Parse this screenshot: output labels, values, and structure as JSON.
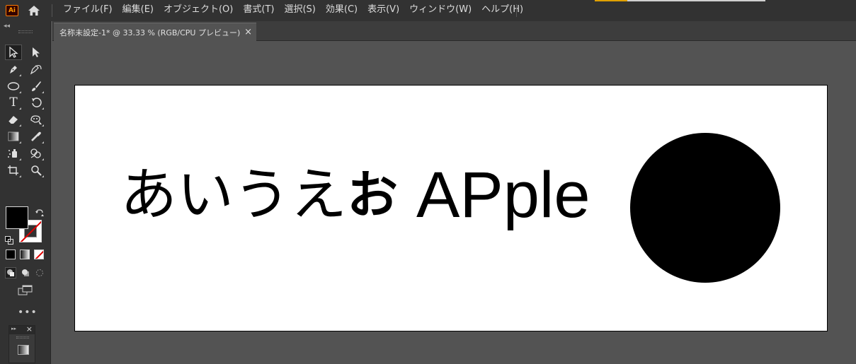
{
  "app": {
    "logo_text": "Ai"
  },
  "menu": {
    "items": [
      "ファイル(F)",
      "編集(E)",
      "オブジェクト(O)",
      "書式(T)",
      "選択(S)",
      "効果(C)",
      "表示(V)",
      "ウィンドウ(W)",
      "ヘルプ(H)"
    ]
  },
  "document_tab": {
    "title": "名称未設定-1* @ 33.33 % (RGB/CPU プレビュー)",
    "close_glyph": "×"
  },
  "toolbar": {
    "collapse_glyph": "◂◂",
    "more_glyph": "•••",
    "mini_panel_expand": "▸▸",
    "mini_panel_close": "×",
    "tools": [
      {
        "name": "selection-tool",
        "icon": "arrow-hollow-icon",
        "active": true
      },
      {
        "name": "direct-selection-tool",
        "icon": "arrow-filled-icon",
        "active": false
      },
      {
        "name": "pen-tool",
        "icon": "pen-icon",
        "active": false
      },
      {
        "name": "curvature-tool",
        "icon": "curvature-pen-icon",
        "active": false
      },
      {
        "name": "ellipse-tool",
        "icon": "ellipse-icon",
        "active": false
      },
      {
        "name": "paintbrush-tool",
        "icon": "brush-icon",
        "active": false
      },
      {
        "name": "type-tool",
        "icon": "type-icon",
        "active": false
      },
      {
        "name": "rotate-tool",
        "icon": "rotate-icon",
        "active": false
      },
      {
        "name": "eraser-tool",
        "icon": "eraser-icon",
        "active": false
      },
      {
        "name": "puppet-warp-tool",
        "icon": "puppet-warp-icon",
        "active": false
      },
      {
        "name": "gradient-tool",
        "icon": "gradient-icon",
        "active": false
      },
      {
        "name": "eyedropper-tool",
        "icon": "eyedropper-icon",
        "active": false
      },
      {
        "name": "symbol-sprayer-tool",
        "icon": "symbol-sprayer-icon",
        "active": false
      },
      {
        "name": "shape-builder-tool",
        "icon": "shape-builder-icon",
        "active": false
      },
      {
        "name": "artboard-tool",
        "icon": "artboard-icon",
        "active": false
      },
      {
        "name": "zoom-tool",
        "icon": "zoom-icon",
        "active": false
      }
    ],
    "type_glyph": "T",
    "fill_color": "#000000",
    "stroke_color": "none"
  },
  "artboard": {
    "text_jp_light": "あいうえ",
    "text_jp_bold": "お",
    "text_latin": "APple",
    "circle_color": "#000000"
  },
  "colors": {
    "accent": "#e0a000",
    "app_bg": "#323232",
    "canvas_bg": "#535353"
  }
}
